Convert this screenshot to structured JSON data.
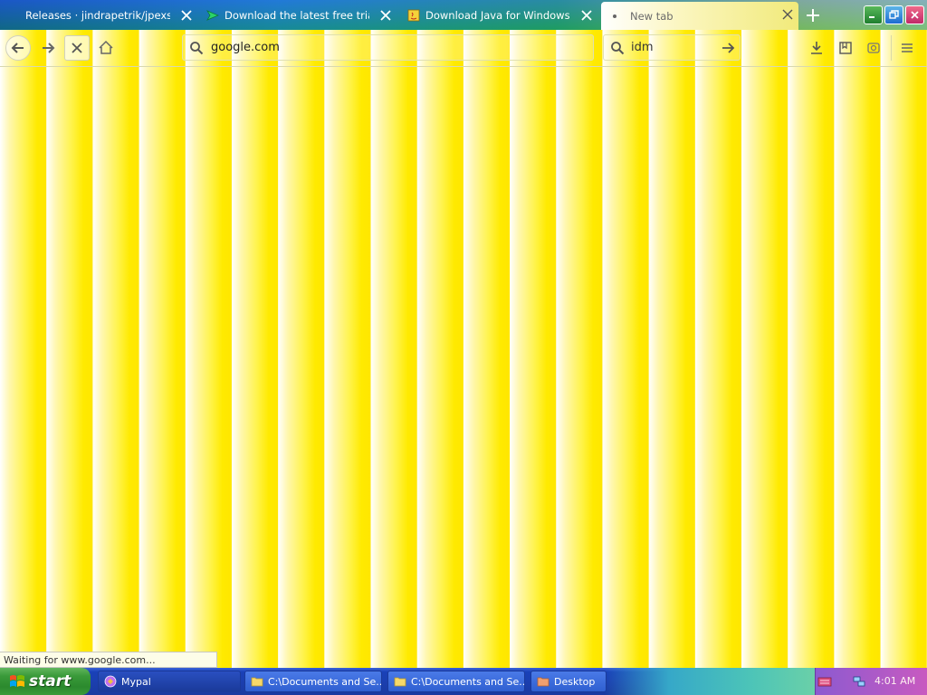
{
  "browser": {
    "tabs": [
      {
        "title": "Releases · jindrapetrik/jpexs-decompiler",
        "favicon": "github-icon",
        "active": false
      },
      {
        "title": "Download the latest free trial version",
        "favicon": "idm-icon",
        "active": false
      },
      {
        "title": "Download Java for Windows",
        "favicon": "java-icon",
        "active": false
      },
      {
        "title": "New tab",
        "favicon": "loading-dot-icon",
        "active": true
      }
    ],
    "address_bar": {
      "value": "google.com",
      "icon": "search-icon"
    },
    "search_box": {
      "value": "idm",
      "icon": "search-icon"
    },
    "status_text": "Waiting for www.google.com..."
  },
  "toolbar_icons": [
    "back-icon",
    "forward-icon",
    "stop-icon",
    "home-icon",
    "download-icon",
    "bookmarks-icon",
    "extension-icon",
    "menu-icon"
  ],
  "taskbar": {
    "start_label": "start",
    "items": [
      {
        "label": "Mypal",
        "icon": "mypal-icon"
      },
      {
        "label": "C:\\Documents and Se...",
        "icon": "folder-icon"
      },
      {
        "label": "C:\\Documents and Se...",
        "icon": "folder-icon"
      },
      {
        "label": "Desktop",
        "icon": "folder-icon"
      }
    ],
    "clock": "4:01 AM"
  },
  "colors": {
    "accent_yellow": "#ffea00",
    "taskbar_blue": "#1941b8",
    "start_green": "#3a9a3a"
  }
}
